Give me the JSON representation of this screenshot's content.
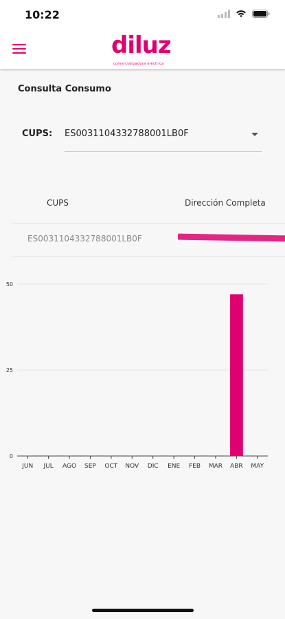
{
  "status_bar": {
    "time": "10:22"
  },
  "header": {
    "logo_text": "diluz",
    "logo_tagline": "comercializadora eléctrica",
    "menu_icon": "hamburger-menu-icon",
    "accent_color": "#e0006f"
  },
  "page": {
    "title": "Consulta Consumo"
  },
  "cups_selector": {
    "label": "CUPS:",
    "value": "ES0031104332788001LB0F"
  },
  "table": {
    "headers": [
      "CUPS",
      "Dirección Completa"
    ],
    "rows": [
      {
        "cups": "ES0031104332788001LB0F",
        "address": ""
      }
    ]
  },
  "chart_data": {
    "type": "bar",
    "categories": [
      "JUN",
      "JUL",
      "AGO",
      "SEP",
      "OCT",
      "NOV",
      "DIC",
      "ENE",
      "FEB",
      "MAR",
      "ABR",
      "MAY"
    ],
    "series": [
      {
        "values": [
          0,
          0,
          0,
          0,
          0,
          0,
          0,
          0,
          0,
          0,
          47,
          0
        ],
        "color": "#e0006f"
      }
    ],
    "yticks": [
      0,
      25,
      50
    ],
    "ylim": [
      0,
      50
    ],
    "grid": true,
    "title": "",
    "xlabel": "",
    "ylabel": ""
  }
}
